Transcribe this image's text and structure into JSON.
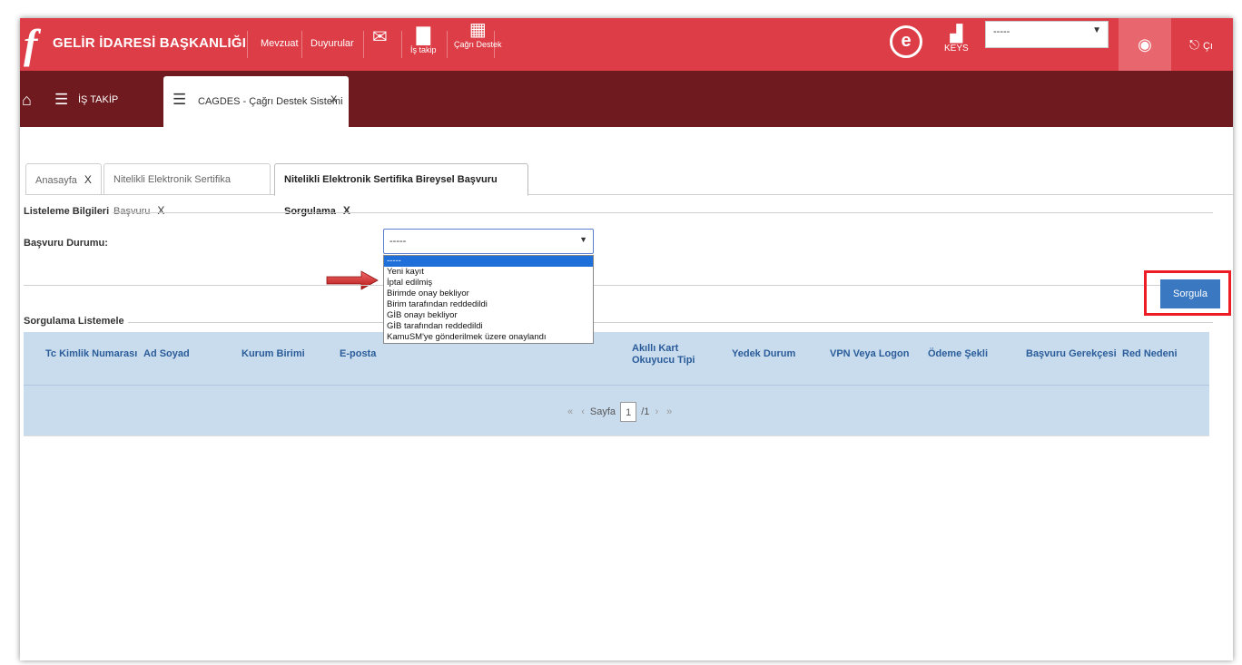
{
  "topbar": {
    "logo_glyph": "f",
    "brand": "GELİR İDARESİ BAŞKANLIĞI",
    "links": [
      "Mevzuat",
      "Duyurular"
    ],
    "istakip_label": "İş takip",
    "cagri_label": "Çağrı Destek",
    "e_logo": "e",
    "keys_label": "KEYS",
    "select_value": "-----",
    "exit_label": "Çı"
  },
  "bar2": {
    "istakip": "İŞ TAKİP",
    "tab_label": "CAGDES - Çağrı Destek Sistemi",
    "tab_close": "X"
  },
  "tabs": [
    {
      "label": "Anasayfa",
      "close": "X"
    },
    {
      "label": "Nitelikli Elektronik Sertifika Başvuru",
      "close": "X"
    },
    {
      "label": "Nitelikli Elektronik Sertifika Bireysel Başvuru Sorgulama",
      "close": "X"
    }
  ],
  "listing": {
    "legend": "Listeleme Bilgileri",
    "label": "Başvuru Durumu:",
    "select_value": "-----",
    "options": [
      "-----",
      "Yeni kayıt",
      "İptal edilmiş",
      "Birimde onay bekliyor",
      "Birim tarafından reddedildi",
      "GİB onayı bekliyor",
      "GİB tarafından reddedildi",
      "KamuSM'ye gönderilmek üzere onaylandı"
    ],
    "selected_index": 0
  },
  "actions": {
    "sorgula": "Sorgula"
  },
  "results": {
    "legend": "Sorgulama Listemele",
    "columns": [
      "Tc Kimlik Numarası",
      "Ad Soyad",
      "Kurum Birimi",
      "E-posta",
      "Akıllı Kart Okuyucu Tipi",
      "Yedek Durum",
      "VPN Veya Logon",
      "Ödeme Şekli",
      "Başvuru Gerekçesi",
      "Red Nedeni"
    ]
  },
  "pager": {
    "first": "«",
    "prev": "‹",
    "page_label": "Sayfa",
    "page": "1",
    "total": "/1",
    "next": "›",
    "last": "»"
  },
  "colors": {
    "topbar": "#dc3d46",
    "bar2": "#6f1a1e",
    "table_header": "#c9dcee",
    "button": "#3b78c2",
    "highlight": "#ee1c24"
  }
}
